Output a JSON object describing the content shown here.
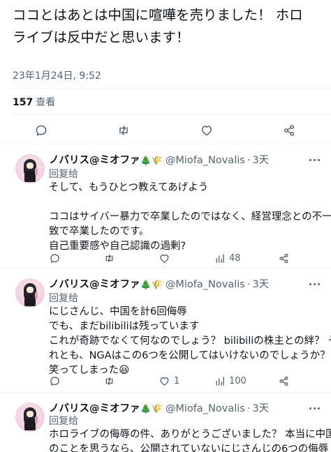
{
  "main_tweet": {
    "lines": [
      "ココとはあとは中国に喧嘩を売りました！ ホロ",
      "ライブは反中だと思います！"
    ],
    "timestamp": "23年1月24日, 9:52",
    "views_count": "157",
    "views_label": "查看"
  },
  "replies": [
    {
      "name": "ノバリス@ミオファ",
      "name_emoji": "🎄🌾",
      "handle": "@Miofa_Novalis",
      "time": "3天",
      "reply_label": "回复给",
      "lines": [
        "そして、もうひとつ教えてあげよう",
        "",
        "ココはサイバー暴力で卒業したのではなく、経営理念との不一",
        "致で卒業したのです。",
        "自己重要感や自己認識の過剰?"
      ],
      "retweets": "",
      "likes": "",
      "views": "48"
    },
    {
      "name": "ノバリス@ミオファ",
      "name_emoji": "🎄🌾",
      "handle": "@Miofa_Novalis",
      "time": "3天",
      "reply_label": "回复给",
      "lines": [
        "にじさんじ、中国を計6回侮辱",
        "でも、まだbilibiliは残っています",
        "これが奇跡でなくて何なのでしょう？ bilibiliの株主との絆？ そ",
        "れとも、NGAはこの6つを公開してはいけないのでしょうか？",
        "笑ってしまった😃"
      ],
      "retweets": "",
      "likes": "1",
      "views": "100"
    },
    {
      "name": "ノバリス@ミオファ",
      "name_emoji": "🎄🌾",
      "handle": "@Miofa_Novalis",
      "time": "3天",
      "reply_label": "回复给",
      "lines": [
        "ホロライブの侮辱の件、ありがとうございました？ 本当に中国",
        "のことを思うなら、公開されていないにじさんじの6つの侮辱"
      ],
      "retweets": "",
      "likes": "",
      "views": ""
    }
  ],
  "icons": {
    "reply": "reply-icon",
    "retweet": "retweet-icon",
    "like": "heart-icon",
    "views": "views-icon",
    "share": "share-icon",
    "more": "more-icon"
  },
  "colors": {
    "text": "#0f1419",
    "secondary": "#536471",
    "divider": "#eff3f4"
  }
}
